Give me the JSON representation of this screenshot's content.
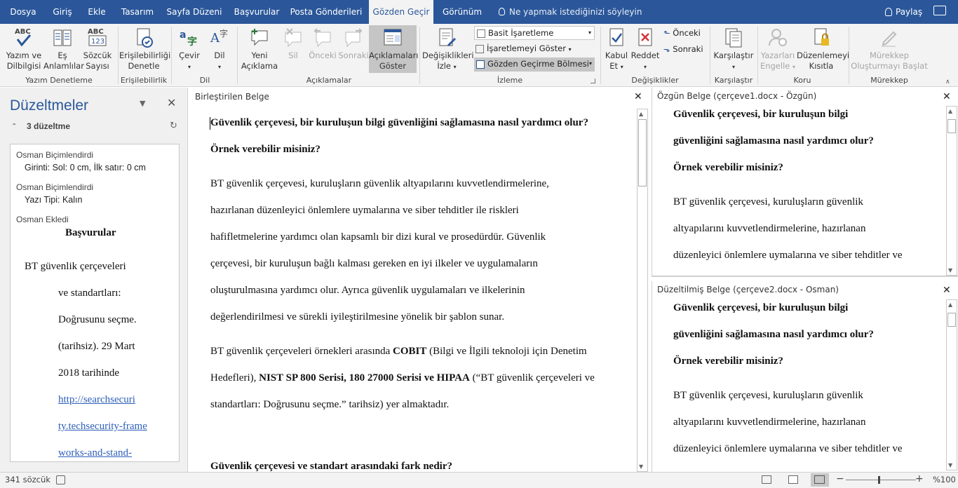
{
  "tabs": [
    "Dosya",
    "Giriş",
    "Ekle",
    "Tasarım",
    "Sayfa Düzeni",
    "Başvurular",
    "Posta Gönderileri",
    "Gözden Geçir",
    "Görünüm"
  ],
  "tell_me": "Ne yapmak istediğinizi söyleyin",
  "share": "Paylaş",
  "ribbon": {
    "b1a": "Yazım ve",
    "b1b": "Dilbilgisi",
    "b2a": "Eş",
    "b2b": "Anlamlılar",
    "b3a": "Sözcük",
    "b3b": "Sayısı",
    "g1": "Yazım Denetleme",
    "b4a": "Erişilebilirliği",
    "b4b": "Denetle",
    "g2": "Erişilebilirlik",
    "b5": "Çevir",
    "b6": "Dil",
    "g3": "Dil",
    "b7a": "Yeni",
    "b7b": "Açıklama",
    "b8": "Sil",
    "b9": "Önceki",
    "b10": "Sonraki",
    "b11a": "Açıklamaları",
    "b11b": "Göster",
    "g4": "Açıklamalar",
    "b12a": "Değişiklikleri",
    "b12b": "İzle",
    "markup_select": "Basit İşaretleme",
    "show_markup": "İşaretlemeyi Göster",
    "review_pane": "Gözden Geçirme Bölmesi",
    "g5": "İzleme",
    "b13a": "Kabul",
    "b13b": "Et",
    "b14": "Reddet",
    "prev": "Önceki",
    "next": "Sonraki",
    "g6": "Değişiklikler",
    "b15": "Karşılaştır",
    "g7": "Karşılaştır",
    "b16a": "Yazarları",
    "b16b": "Engelle",
    "b17a": "Düzenlemeyi",
    "b17b": "Kısıtla",
    "g8": "Koru",
    "b18a": "Mürekkep",
    "b18b": "Oluşturmayı Başlat",
    "g9": "Mürekkep"
  },
  "revisions": {
    "title": "Düzeltmeler",
    "count": "3 düzeltme",
    "r1_author": "Osman Biçimlendirdi",
    "r1_detail": "Girinti: Sol: 0 cm, İlk satır: 0 cm",
    "r2_author": "Osman Biçimlendirdi",
    "r2_detail": "Yazı Tipi: Kalın",
    "r3_author": "Osman Ekledi",
    "r3_heading": "Başvurular",
    "r3_lines": [
      "BT güvenlik çerçeveleri",
      "ve standartları:",
      "Doğrusunu seçme.",
      "(tarihsiz). 29 Mart",
      "2018 tarihinde"
    ],
    "r3_links": [
      "http://searchsecuri",
      "ty.techsecurity-frame",
      "works-and-stand-"
    ]
  },
  "main": {
    "title": "Birleştirilen Belge",
    "h1": "Güvenlik çerçevesi, bir kuruluşun bilgi güvenliğini sağlamasına nasıl yardımcı olur?",
    "h2": "Örnek verebilir misiniz?",
    "p1": [
      "BT güvenlik çerçevesi, kuruluşların güvenlik altyapılarını kuvvetlendirmelerine,",
      "hazırlanan düzenleyici önlemlere uymalarına ve siber tehditler ile riskleri",
      "hafifletmelerine yardımcı olan kapsamlı bir dizi kural ve prosedürdür. Güvenlik",
      "çerçevesi, bir kuruluşun bağlı kalması gereken en iyi ilkeler ve uygulamaların",
      "oluşturulmasına yardımcı olur. Ayrıca güvenlik uygulamaları ve ilkelerinin",
      "değerlendirilmesi ve sürekli iyileştirilmesine yönelik bir şablon sunar."
    ],
    "p2a_pre": "BT güvenlik çerçeveleri örnekleri arasında ",
    "p2a_b": "COBIT",
    "p2a_post": " (Bilgi ve İlgili teknoloji için Denetim",
    "p2b_pre": "Hedefleri), ",
    "p2b_b": "NIST SP 800 Serisi, 180 27000 Serisi ve HIPAA",
    "p2b_post": " (“BT güvenlik çerçeveleri ve",
    "p2c": "standartları: Doğrusunu seçme.” tarihsiz) yer almaktadır.",
    "h3": "Güvenlik çerçevesi ve standart arasındaki fark nedir?"
  },
  "orig": {
    "title": "Özgün Belge (çerçeve1.docx - Özgün)",
    "h": [
      "Güvenlik çerçevesi, bir kuruluşun bilgi",
      "güvenliğini sağlamasına nasıl yardımcı olur?",
      "Örnek verebilir misiniz?"
    ],
    "p": [
      "BT güvenlik çerçevesi, kuruluşların güvenlik",
      "altyapılarını kuvvetlendirmelerine, hazırlanan",
      "düzenleyici önlemlere uymalarına ve siber tehditler ve"
    ]
  },
  "rev": {
    "title": "Düzeltilmiş Belge (çerçeve2.docx - Osman)",
    "h": [
      "Güvenlik çerçevesi, bir kuruluşun bilgi",
      "güvenliğini sağlamasına nasıl yardımcı olur?",
      "Örnek verebilir misiniz?"
    ],
    "p": [
      "BT güvenlik çerçevesi, kuruluşların güvenlik",
      "altyapılarını kuvvetlendirmelerine, hazırlanan",
      "düzenleyici önlemlere uymalarına ve siber tehditler ve"
    ]
  },
  "status": {
    "words": "341 sözcük",
    "zoom": "%100"
  },
  "colors": {
    "accent": "#2b579a",
    "link": "#2e5fb8"
  }
}
